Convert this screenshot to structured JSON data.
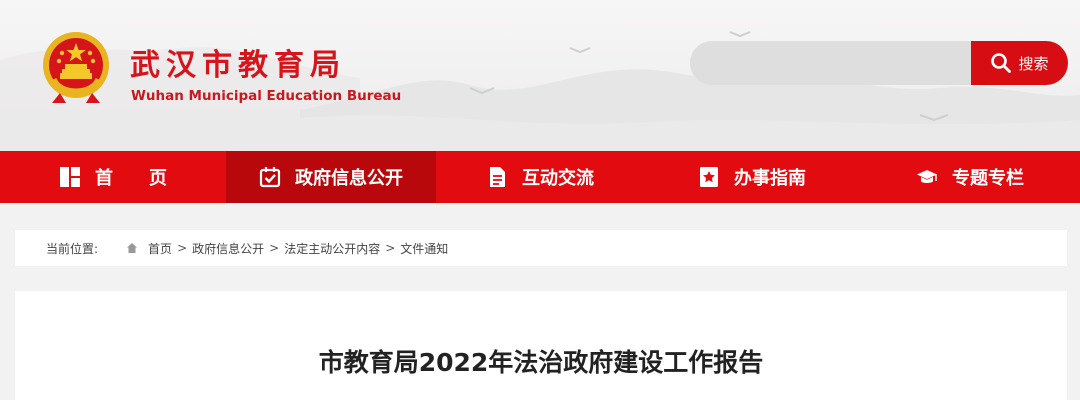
{
  "header": {
    "site_name_cn": "武汉市教育局",
    "site_name_en": "Wuhan Municipal Education Bureau",
    "emblem_icon": "national-emblem-icon"
  },
  "search": {
    "placeholder": "",
    "button_label": "搜索",
    "icon": "search-icon"
  },
  "nav": {
    "items": [
      {
        "label": "首页",
        "icon": "home-grid-icon"
      },
      {
        "label": "政府信息公开",
        "icon": "calendar-check-icon",
        "active": true
      },
      {
        "label": "互动交流",
        "icon": "document-icon"
      },
      {
        "label": "办事指南",
        "icon": "bookmark-star-icon"
      },
      {
        "label": "专题专栏",
        "icon": "graduation-cap-icon"
      }
    ]
  },
  "breadcrumb": {
    "label": "当前位置:",
    "home_icon": "home-icon",
    "items": [
      "首页",
      "政府信息公开",
      "法定主动公开内容",
      "文件通知"
    ],
    "separator": ">"
  },
  "article": {
    "title": "市教育局2022年法治政府建设工作报告"
  },
  "colors": {
    "brand_red": "#e20c10",
    "active_nav": "#b8080b",
    "title_red": "#d5151a"
  }
}
